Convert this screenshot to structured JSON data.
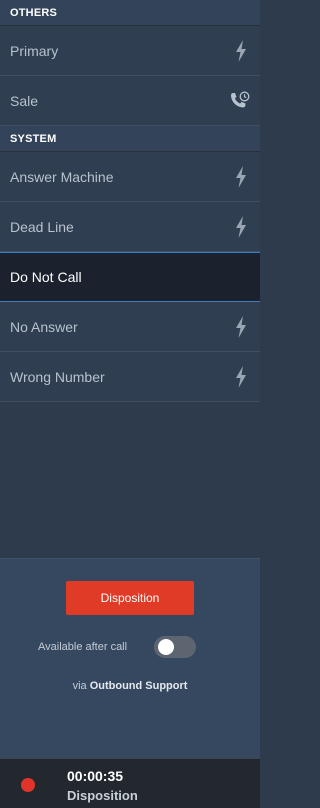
{
  "sections": [
    {
      "title": "OTHERS",
      "items": [
        {
          "label": "Primary",
          "icon": "lightning-icon"
        },
        {
          "label": "Sale",
          "icon": "phone-clock-icon"
        }
      ]
    },
    {
      "title": "SYSTEM",
      "items": [
        {
          "label": "Answer Machine",
          "icon": "lightning-icon"
        },
        {
          "label": "Dead Line",
          "icon": "lightning-icon"
        },
        {
          "label": "Do Not Call",
          "icon": "",
          "selected": true
        },
        {
          "label": "No Answer",
          "icon": "lightning-icon"
        },
        {
          "label": "Wrong Number",
          "icon": "lightning-icon"
        }
      ]
    }
  ],
  "footer": {
    "disposition_button": "Disposition",
    "available_after_call_label": "Available after call",
    "available_after_call_enabled": false,
    "via_prefix": "via",
    "via_name": "Outbound Support"
  },
  "status": {
    "timer": "00:00:35",
    "label": "Disposition"
  },
  "colors": {
    "accent_red": "#df3b27",
    "selected_border": "#3d7ec0",
    "recording_dot": "#e0342a"
  }
}
